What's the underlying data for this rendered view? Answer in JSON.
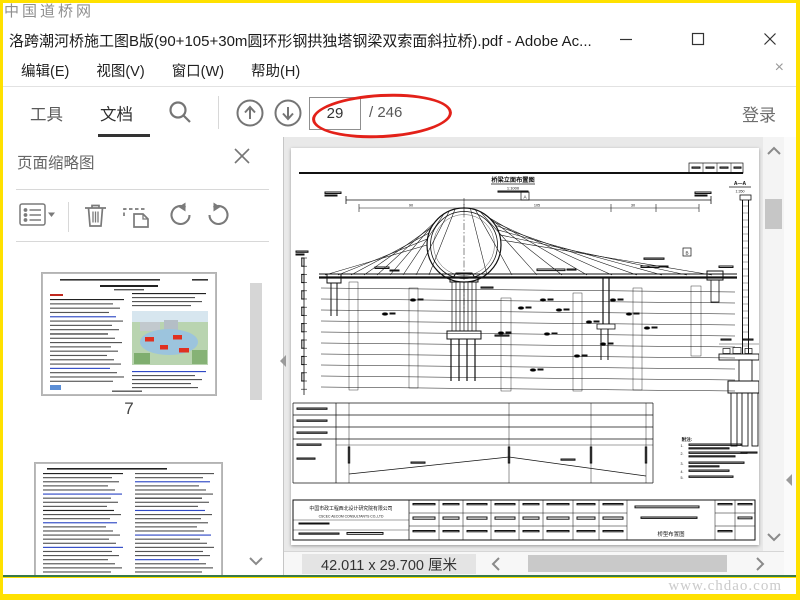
{
  "watermark_top": "中国道桥网",
  "watermark_bottom": "www.chdao.com",
  "titlebar": {
    "title": "洛跨潮河桥施工图B版(90+105+30m圆环形钢拱独塔钢梁双索面斜拉桥).pdf - Adobe Ac..."
  },
  "menubar": {
    "items": [
      {
        "label": "编辑(E)"
      },
      {
        "label": "视图(V)"
      },
      {
        "label": "窗口(W)"
      },
      {
        "label": "帮助(H)"
      }
    ]
  },
  "toolbar": {
    "tools": "工具",
    "document": "文档",
    "page_current": "29",
    "page_total": "/ 246",
    "sign_in": "登录"
  },
  "panel": {
    "title": "页面缩略图",
    "page7_label": "7"
  },
  "statusbar": {
    "page_size": "42.011 x 29.700 厘米"
  },
  "drawing": {
    "title": "桥梁立面布置图",
    "scale": "1:1000",
    "span_90": "90",
    "span_105": "105",
    "span_30": "30",
    "label_a": "A",
    "label_b": "B",
    "section_label": "A—A",
    "section_scale": "1:350",
    "notes_title": "附注:",
    "note_numbers": [
      "1.",
      "2.",
      "3.",
      "4.",
      "5."
    ],
    "titleblock": {
      "company_cn": "中国市政工程西北设计研究院有限公司",
      "company_en": "CSCEC AECOM CONSULTANTS CO.,LTD",
      "drawing_name": "桥型布置图"
    }
  }
}
